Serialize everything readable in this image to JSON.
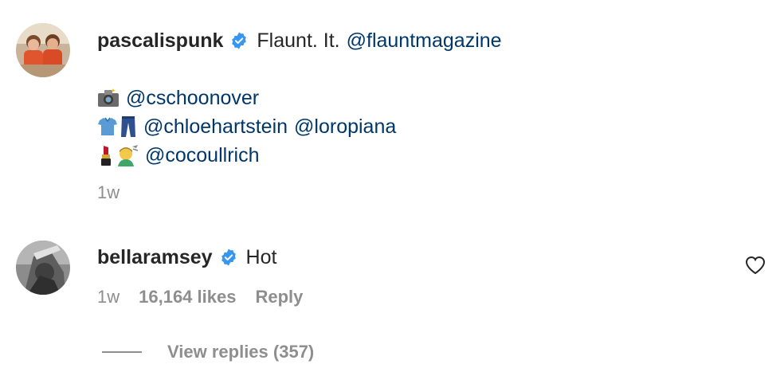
{
  "comments": [
    {
      "username": "pascalispunk",
      "caption_text": "Flaunt. It.",
      "caption_mention": "@flauntmagazine",
      "credits": [
        {
          "icons": [
            "camera-icon"
          ],
          "mentions": [
            "@cschoonover"
          ]
        },
        {
          "icons": [
            "shirt-icon",
            "jeans-icon"
          ],
          "mentions": [
            "@chloehartstein",
            "@loropiana"
          ]
        },
        {
          "icons": [
            "lipstick-icon",
            "hairdresser-icon"
          ],
          "mentions": [
            "@cocoullrich"
          ]
        }
      ],
      "time": "1w"
    },
    {
      "username": "bellaramsey",
      "text": "Hot",
      "time": "1w",
      "likes": "16,164 likes",
      "reply_label": "Reply",
      "view_replies_label": "View replies (357)"
    }
  ],
  "colors": {
    "mention": "#00376b",
    "verified": "#3797f0",
    "secondary_text": "#8e8e8e",
    "primary_text": "#262626"
  }
}
